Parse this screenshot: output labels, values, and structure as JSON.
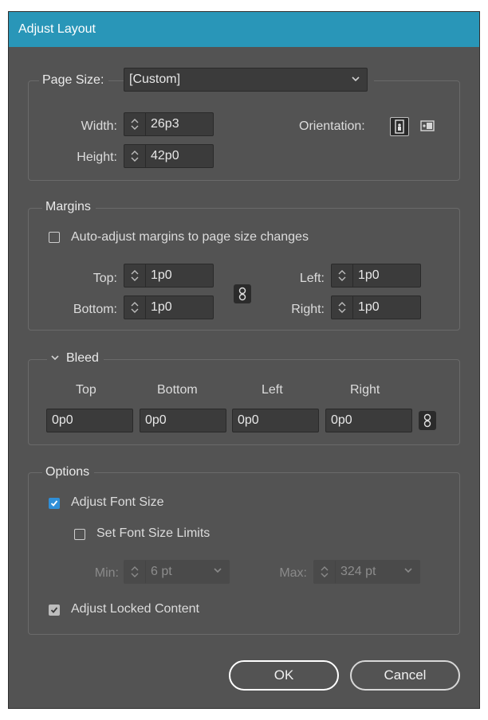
{
  "dialog": {
    "title": "Adjust Layout"
  },
  "page_size": {
    "label": "Page Size:",
    "value": "[Custom]",
    "width_label": "Width:",
    "width_value": "26p3",
    "height_label": "Height:",
    "height_value": "42p0",
    "orientation_label": "Orientation:"
  },
  "margins": {
    "legend": "Margins",
    "auto_adjust_label": "Auto-adjust margins to page size changes",
    "top_label": "Top:",
    "top_value": "1p0",
    "bottom_label": "Bottom:",
    "bottom_value": "1p0",
    "left_label": "Left:",
    "left_value": "1p0",
    "right_label": "Right:",
    "right_value": "1p0"
  },
  "bleed": {
    "legend": "Bleed",
    "top_label": "Top",
    "bottom_label": "Bottom",
    "left_label": "Left",
    "right_label": "Right",
    "top_value": "0p0",
    "bottom_value": "0p0",
    "left_value": "0p0",
    "right_value": "0p0"
  },
  "options": {
    "legend": "Options",
    "adjust_font_size_label": "Adjust Font Size",
    "set_font_limits_label": "Set Font Size Limits",
    "min_label": "Min:",
    "min_value": "6 pt",
    "max_label": "Max:",
    "max_value": "324 pt",
    "adjust_locked_label": "Adjust Locked Content"
  },
  "buttons": {
    "ok": "OK",
    "cancel": "Cancel"
  },
  "colors": {
    "titlebar": "#2996b8",
    "panel": "#535353",
    "checkbox_accent": "#2f8fd8"
  }
}
